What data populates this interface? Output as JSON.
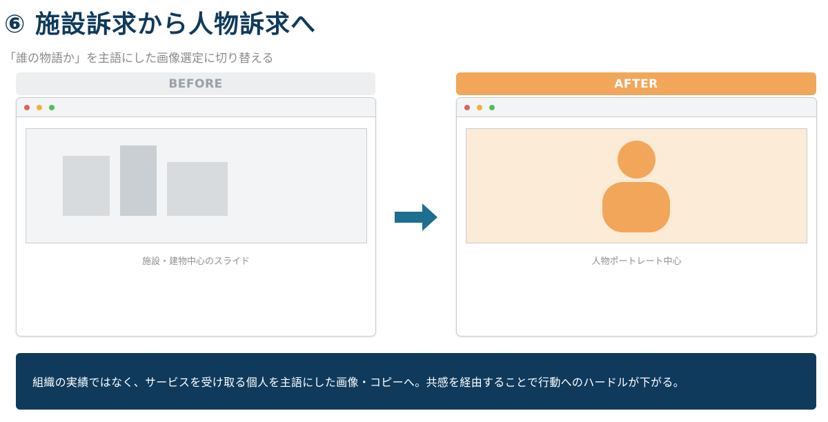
{
  "title": "⑥ 施設訴求から人物訴求へ",
  "subtitle": "「誰の物語か」を主語にした画像選定に切り替える",
  "before": {
    "label": "BEFORE",
    "caption": "施設・建物中心のスライド"
  },
  "after": {
    "label": "AFTER",
    "caption": "人物ポートレート中心"
  },
  "footer_text": "組織の実績ではなく、サービスを受け取る個人を主語にした画像・コピーへ。共感を経由することで行動へのハードルが下がる。",
  "colors": {
    "navy": "#0f3a5c",
    "orange": "#f2a65a",
    "arrow": "#1d6e8f"
  }
}
